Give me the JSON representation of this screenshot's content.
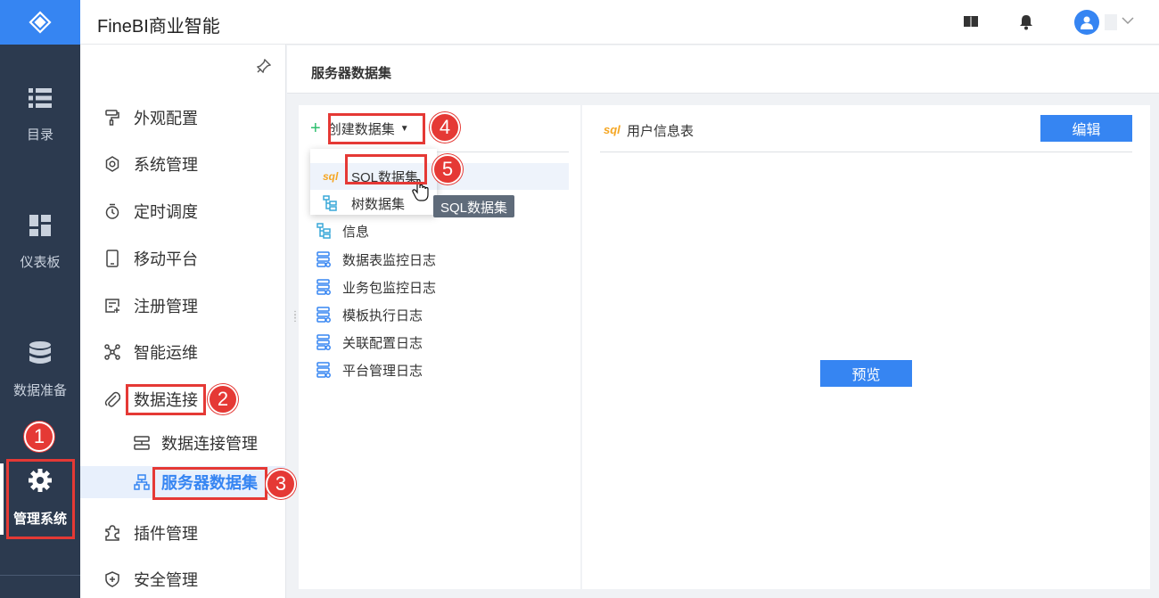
{
  "header": {
    "app_title": "FineBI商业智能"
  },
  "rail": {
    "items": [
      {
        "label": "目录",
        "icon": "list-icon"
      },
      {
        "label": "仪表板",
        "icon": "dashboard-icon"
      },
      {
        "label": "数据准备",
        "icon": "database-icon"
      },
      {
        "label": "管理系统",
        "icon": "gear-icon",
        "active": true
      }
    ]
  },
  "sidebar": {
    "items": [
      {
        "label": "外观配置",
        "icon": "paint-roller-icon"
      },
      {
        "label": "系统管理",
        "icon": "settings-icon"
      },
      {
        "label": "定时调度",
        "icon": "timer-icon"
      },
      {
        "label": "移动平台",
        "icon": "mobile-icon"
      },
      {
        "label": "注册管理",
        "icon": "register-icon"
      },
      {
        "label": "智能运维",
        "icon": "network-icon"
      },
      {
        "label": "数据连接",
        "icon": "paperclip-icon"
      },
      {
        "label": "插件管理",
        "icon": "puzzle-icon"
      },
      {
        "label": "安全管理",
        "icon": "shield-icon"
      }
    ],
    "sub_items": [
      {
        "label": "数据连接管理",
        "icon": "connection-icon"
      },
      {
        "label": "服务器数据集",
        "icon": "dataset-icon",
        "selected": true
      }
    ]
  },
  "page": {
    "title": "服务器数据集"
  },
  "left_panel": {
    "create_label": "创建数据集",
    "dropdown": [
      {
        "label": "SQL数据集",
        "icon": "sql-icon"
      },
      {
        "label": "树数据集",
        "icon": "tree-icon"
      }
    ],
    "tooltip": "SQL数据集",
    "tree": [
      {
        "label": "信息",
        "icon": "tree-icon"
      },
      {
        "label": "数据表监控日志",
        "icon": "db-table-icon"
      },
      {
        "label": "业务包监控日志",
        "icon": "db-table-icon"
      },
      {
        "label": "模板执行日志",
        "icon": "db-table-icon"
      },
      {
        "label": "关联配置日志",
        "icon": "db-table-icon"
      },
      {
        "label": "平台管理日志",
        "icon": "db-table-icon"
      }
    ]
  },
  "right_panel": {
    "sql_tag": "sql",
    "title": "用户信息表",
    "edit_label": "编辑",
    "preview_label": "预览"
  },
  "annotations": [
    "1",
    "2",
    "3",
    "4",
    "5"
  ],
  "colors": {
    "accent": "#3685f2",
    "rail_bg": "#2c3a4f",
    "annotation": "#e53935"
  }
}
